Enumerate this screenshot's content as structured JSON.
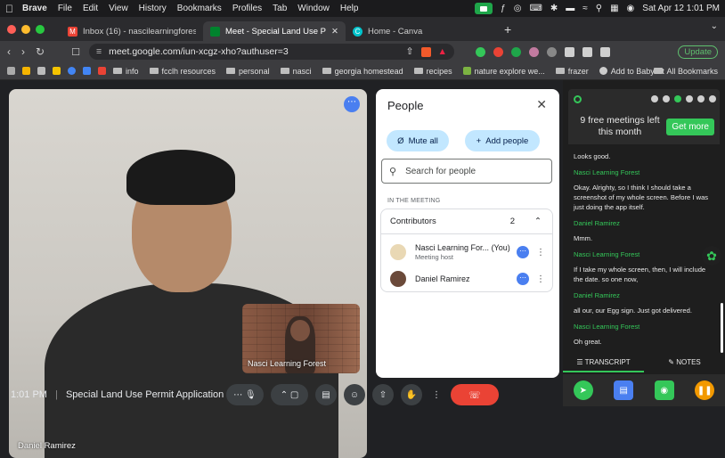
{
  "menubar": {
    "apple": "",
    "app": "Brave",
    "items": [
      "File",
      "Edit",
      "View",
      "History",
      "Bookmarks",
      "Profiles",
      "Tab",
      "Window",
      "Help"
    ],
    "clock": "Sat Apr 12  1:01 PM"
  },
  "tabs": [
    {
      "title": "Inbox (16) - nascilearningforest@",
      "color": "#ea4335",
      "fav": "M"
    },
    {
      "title": "Meet - Special Land Use P",
      "color": "#00832d",
      "fav": ""
    },
    {
      "title": "Home - Canva",
      "color": "#00c4cc",
      "fav": "C"
    }
  ],
  "address": {
    "url": "meet.google.com/iun-xcgz-xho?authuser=3",
    "update_label": "Update"
  },
  "bookmarks": [
    "info",
    "fcclh resources",
    "personal",
    "nasci",
    "georgia homestead",
    "recipes",
    "nature explore we...",
    "frazer",
    "Add to Babylist"
  ],
  "all_bookmarks": "All Bookmarks",
  "video": {
    "main_name": "Daniel Ramirez",
    "pip_name": "Nasci Learning Forest"
  },
  "controls": {
    "time": "1:01 PM",
    "separator": "|",
    "meeting_title": "Special Land Use Permit Application Co..."
  },
  "people_panel": {
    "title": "People",
    "mute_all": "Mute all",
    "add_people": "Add people",
    "search_placeholder": "Search for people",
    "section_label": "IN THE MEETING",
    "group_label": "Contributors",
    "group_count": "2",
    "participants": [
      {
        "name": "Nasci Learning For...",
        "tag": "(You)",
        "sub": "Meeting host"
      },
      {
        "name": "Daniel Ramirez",
        "tag": "",
        "sub": ""
      }
    ]
  },
  "transcript": {
    "promo_text": "9 free meetings left this month",
    "promo_button": "Get more",
    "entries": [
      {
        "speaker": "",
        "text": "Looks good."
      },
      {
        "speaker": "Nasci Learning Forest",
        "text": "Okay. Alrighty, so I think I should take a screenshot of my whole screen. Before I was just doing the app itself."
      },
      {
        "speaker": "Daniel Ramirez",
        "text": "Mmm."
      },
      {
        "speaker": "Nasci Learning Forest",
        "text": "If I take my whole screen, then, I will include the date. so one now,"
      },
      {
        "speaker": "Daniel Ramirez",
        "text": "all our, our Egg sign. Just got delivered."
      },
      {
        "speaker": "Nasci Learning Forest",
        "text": "Oh great."
      }
    ],
    "tab_transcript": "TRANSCRIPT",
    "tab_notes": "NOTES"
  },
  "colors": {
    "accent_green": "#34c759",
    "meet_blue": "#4a7ff0",
    "end_call": "#ea4335"
  }
}
